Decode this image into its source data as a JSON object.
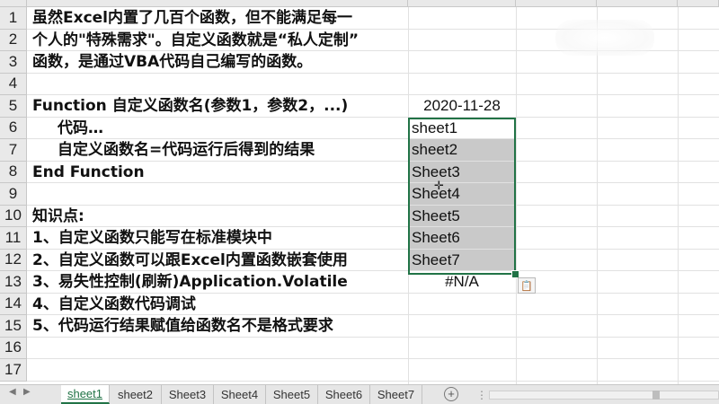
{
  "row_numbers": [
    "1",
    "2",
    "3",
    "4",
    "5",
    "6",
    "7",
    "8",
    "9",
    "10",
    "11",
    "12",
    "13",
    "14",
    "15",
    "16",
    "17"
  ],
  "column_a": [
    {
      "row": 1,
      "text": "虽然Excel内置了几百个函数，但不能满足每一",
      "indent": false
    },
    {
      "row": 2,
      "text": "个人的\"特殊需求\"。自定义函数就是“私人定制”",
      "indent": false
    },
    {
      "row": 3,
      "text": "函数，是通过VBA代码自己编写的函数。",
      "indent": false
    },
    {
      "row": 5,
      "text": "Function 自定义函数名(参数1，参数2，...)",
      "indent": false
    },
    {
      "row": 6,
      "text": "代码…",
      "indent": true
    },
    {
      "row": 7,
      "text": "自定义函数名=代码运行后得到的结果",
      "indent": true
    },
    {
      "row": 8,
      "text": "End Function",
      "indent": false
    },
    {
      "row": 10,
      "text": "知识点:",
      "indent": false
    },
    {
      "row": 11,
      "text": "1、自定义函数只能写在标准模块中",
      "indent": false
    },
    {
      "row": 12,
      "text": "2、自定义函数可以跟Excel内置函数嵌套使用",
      "indent": false
    },
    {
      "row": 13,
      "text": "3、易失性控制(刷新)Application.Volatile",
      "indent": false
    },
    {
      "row": 14,
      "text": "4、自定义函数代码调试",
      "indent": false
    },
    {
      "row": 15,
      "text": "5、代码运行结果赋值给函数名不是格式要求",
      "indent": false
    }
  ],
  "column_e": [
    {
      "row": 5,
      "text": "2020-11-28",
      "selected": false,
      "align": "center"
    },
    {
      "row": 6,
      "text": "sheet1",
      "selected": false,
      "align": "left"
    },
    {
      "row": 7,
      "text": "sheet2",
      "selected": true,
      "align": "left"
    },
    {
      "row": 8,
      "text": "Sheet3",
      "selected": true,
      "align": "left"
    },
    {
      "row": 9,
      "text": "Sheet4",
      "selected": true,
      "align": "left"
    },
    {
      "row": 10,
      "text": "Sheet5",
      "selected": true,
      "align": "left"
    },
    {
      "row": 11,
      "text": "Sheet6",
      "selected": true,
      "align": "left"
    },
    {
      "row": 12,
      "text": "Sheet7",
      "selected": true,
      "align": "left"
    },
    {
      "row": 13,
      "text": "#N/A",
      "selected": false,
      "align": "center"
    }
  ],
  "sheet_tabs": [
    "sheet1",
    "sheet2",
    "Sheet3",
    "Sheet4",
    "Sheet5",
    "Sheet6",
    "Sheet7"
  ],
  "active_tab": "sheet1",
  "add_sheet_label": "+",
  "paste_options_icon": "clipboard-icon",
  "selection_color": "#217346"
}
